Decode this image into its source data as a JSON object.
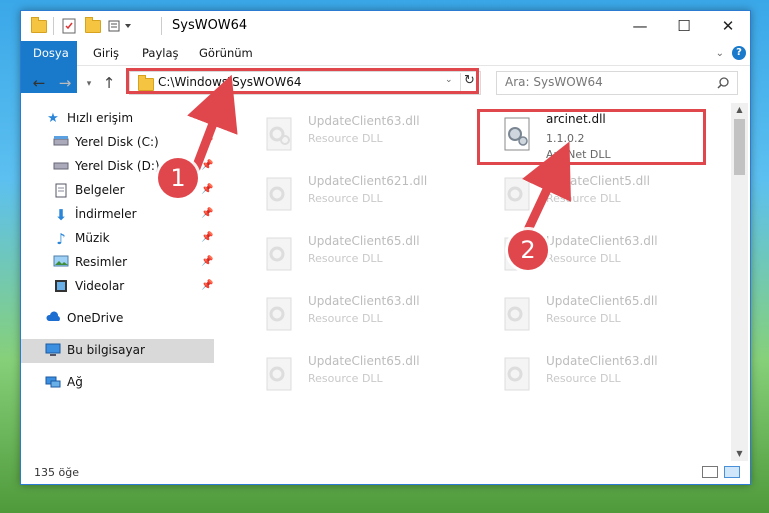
{
  "window": {
    "title": "SysWOW64",
    "controls": {
      "minimize": "—",
      "maximize": "☐",
      "close": "✕"
    }
  },
  "ribbon": {
    "tabs": [
      "Dosya",
      "Giriş",
      "Paylaş",
      "Görünüm"
    ],
    "help": "?"
  },
  "address": {
    "path": "C:\\Windows\\SysWOW64",
    "refresh": "↻"
  },
  "search": {
    "placeholder": "Ara: SysWOW64",
    "icon": "search-icon"
  },
  "sidebar": {
    "items": [
      {
        "label": "Hızlı erişim",
        "icon": "star-icon",
        "pinned": false
      },
      {
        "label": "Yerel Disk (C:)",
        "icon": "drive-icon",
        "pinned": true
      },
      {
        "label": "Yerel Disk (D:)",
        "icon": "drive-icon",
        "pinned": true
      },
      {
        "label": "Belgeler",
        "icon": "documents-icon",
        "pinned": true
      },
      {
        "label": "İndirmeler",
        "icon": "download-icon",
        "pinned": true
      },
      {
        "label": "Müzik",
        "icon": "music-icon",
        "pinned": true
      },
      {
        "label": "Resimler",
        "icon": "pictures-icon",
        "pinned": true
      },
      {
        "label": "Videolar",
        "icon": "videos-icon",
        "pinned": true
      },
      {
        "label": "OneDrive",
        "icon": "cloud-icon",
        "pinned": false
      },
      {
        "label": "Bu bilgisayar",
        "icon": "computer-icon",
        "pinned": false,
        "selected": true
      },
      {
        "label": "Ağ",
        "icon": "network-icon",
        "pinned": false
      }
    ]
  },
  "files": [
    {
      "name": "UpdateClient63.dll",
      "type": "Resource DLL"
    },
    {
      "name": "arcinet.dll",
      "version": "1.1.0.2",
      "type": "ArcINet DLL",
      "highlighted": true
    },
    {
      "name": "UpdateClient621.dll",
      "type": "Resource DLL"
    },
    {
      "name": "UpdateClient5.dll",
      "type": "Resource DLL"
    },
    {
      "name": "UpdateClient65.dll",
      "type": "Resource DLL"
    },
    {
      "name": "UpdateClient63.dll",
      "type": "Resource DLL"
    },
    {
      "name": "UpdateClient63.dll",
      "type": "Resource DLL"
    },
    {
      "name": "UpdateClient65.dll",
      "type": "Resource DLL"
    },
    {
      "name": "UpdateClient65.dll",
      "type": "Resource DLL"
    },
    {
      "name": "UpdateClient63.dll",
      "type": "Resource DLL"
    }
  ],
  "status": {
    "count": "135 öğe"
  },
  "annotations": {
    "step1": "1",
    "step2": "2",
    "color": "#e0474c"
  },
  "colors": {
    "accent": "#1979ca",
    "selection": "#d9d9d9"
  }
}
